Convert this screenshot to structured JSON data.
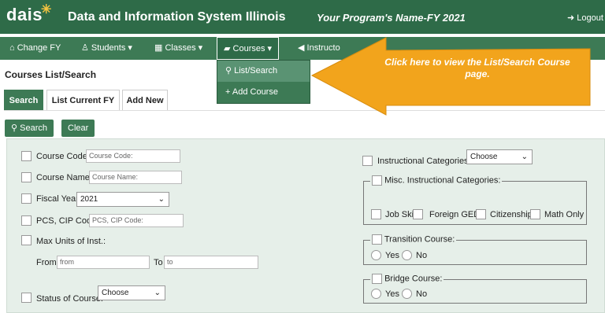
{
  "header": {
    "logo": "dais",
    "title": "Data and Information System Illinois",
    "program": "Your Program's Name-FY 2021",
    "logout": "Logout"
  },
  "nav": {
    "change_fy": "Change FY",
    "students": "Students",
    "classes": "Classes",
    "courses": "Courses",
    "instructors": "Instructo"
  },
  "courses_menu": {
    "list_search": "List/Search",
    "add_course": "Add Course"
  },
  "callout": {
    "text": "Click here to view the List/Search Course page."
  },
  "page": {
    "title": "Courses List/Search"
  },
  "tabs": {
    "search": "Search",
    "list_current": "List Current FY",
    "add_new": "Add New"
  },
  "buttons": {
    "search": "Search",
    "clear": "Clear"
  },
  "form": {
    "course_code": {
      "label": "Course Code:",
      "placeholder": "Course Code:"
    },
    "course_name": {
      "label": "Course Name:",
      "placeholder": "Course Name:"
    },
    "fiscal_year": {
      "label": "Fiscal Year:",
      "value": "2021"
    },
    "pcs_cip": {
      "label": "PCS, CIP Code:",
      "placeholder": "PCS, CIP Code:"
    },
    "max_units": {
      "label": "Max Units of Inst.:",
      "from_label": "From",
      "from_placeholder": "from",
      "to_label": "To",
      "to_placeholder": "to"
    },
    "status": {
      "label": "Status of Course:",
      "value": "Choose"
    },
    "instructional_categories": {
      "label": "Instructional Categories:",
      "value": "Choose"
    },
    "misc_categories": {
      "label": "Misc. Instructional Categories:",
      "options": [
        "Job Skill",
        "Foreign GED",
        "Citizenship",
        "Math Only"
      ]
    },
    "transition": {
      "label": "Transition Course:",
      "yes": "Yes",
      "no": "No"
    },
    "bridge": {
      "label": "Bridge Course:",
      "yes": "Yes",
      "no": "No"
    }
  }
}
